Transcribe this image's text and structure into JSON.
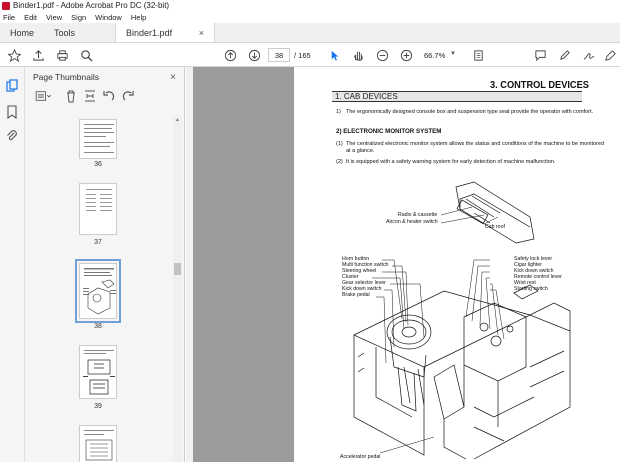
{
  "window": {
    "title": "Binder1.pdf - Adobe Acrobat Pro DC (32-bit)"
  },
  "menu": [
    "File",
    "Edit",
    "View",
    "Sign",
    "Window",
    "Help"
  ],
  "tabs": {
    "home": "Home",
    "tools": "Tools",
    "document": "Binder1.pdf",
    "close": "×"
  },
  "toolbar": {
    "page_current": "38",
    "page_total": "/  165",
    "zoom": "66.7%"
  },
  "panel": {
    "title": "Page Thumbnails",
    "close": "×",
    "thumbnails": [
      {
        "label": "36"
      },
      {
        "label": "37"
      },
      {
        "label": "38"
      },
      {
        "label": "39"
      },
      {
        "label": ""
      }
    ]
  },
  "document": {
    "chapter_title": "3. CONTROL DEVICES",
    "section": "1. CAB DEVICES",
    "p1_num": "1)",
    "p1": "The ergonomically designed console box and suspension type seat provide the operator with comfort.",
    "sub2": "2) ELECTRONIC MONITOR SYSTEM",
    "p2_num": "(1)",
    "p2": "The centralized electronic monitor system allows the status and conditions of the machine to be monitored at a glance.",
    "p3_num": "(2)",
    "p3": "It is equipped with a safety warning system for early detection of machine malfunction.",
    "callouts_top": [
      "Radio & cassette",
      "Aircon & heater switch",
      "Cab roof"
    ],
    "callouts_left": [
      "Horn button",
      "Multi function switch",
      "Steering wheel",
      "Cluster",
      "Gear selector lever",
      "Kick down switch",
      "Brake pedal"
    ],
    "callouts_right": [
      "Safety lock lever",
      "Cigar lighter",
      "Kick down switch",
      "Remote control lever",
      "Wrist rest",
      "Starting switch"
    ],
    "callout_bottom": "Accelerator pedal"
  }
}
